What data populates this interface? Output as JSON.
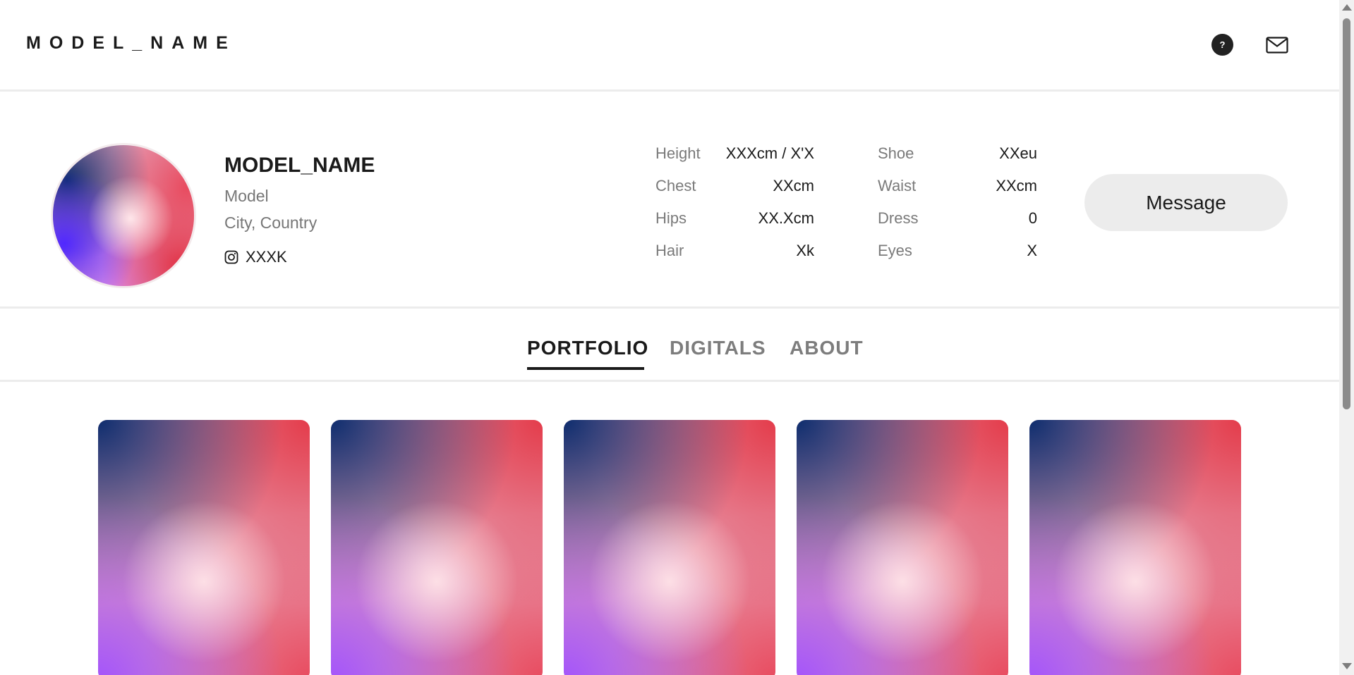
{
  "header": {
    "brand": "MODEL_NAME",
    "help_icon_glyph": "?",
    "icons": [
      "help-icon",
      "mail-icon"
    ]
  },
  "profile": {
    "name": "MODEL_NAME",
    "role": "Model",
    "location": "City, Country",
    "instagram_followers": "XXXK",
    "instagram_icon": "instagram-icon",
    "stats_left": [
      {
        "label": "Height",
        "value": "XXXcm / X'X"
      },
      {
        "label": "Chest",
        "value": "XXcm"
      },
      {
        "label": "Hips",
        "value": "XX.Xcm"
      },
      {
        "label": "Hair",
        "value": "Xk"
      }
    ],
    "stats_right": [
      {
        "label": "Shoe",
        "value": "XXeu"
      },
      {
        "label": "Waist",
        "value": "XXcm"
      },
      {
        "label": "Dress",
        "value": "0"
      },
      {
        "label": "Eyes",
        "value": "X"
      }
    ],
    "message_button": "Message"
  },
  "tabs": [
    {
      "label": "PORTFOLIO",
      "active": true
    },
    {
      "label": "DIGITALS",
      "active": false
    },
    {
      "label": "ABOUT",
      "active": false
    }
  ],
  "colors": {
    "text": "#1a1a1a",
    "muted": "#777777",
    "divider": "#ececec",
    "button_bg": "#ececec",
    "gradient_navy": "#0e2d6e",
    "gradient_red": "#e43c4b",
    "gradient_violet": "#a050ff",
    "gradient_pink": "#ffe4e8"
  },
  "portfolio": {
    "card_count": 5
  }
}
